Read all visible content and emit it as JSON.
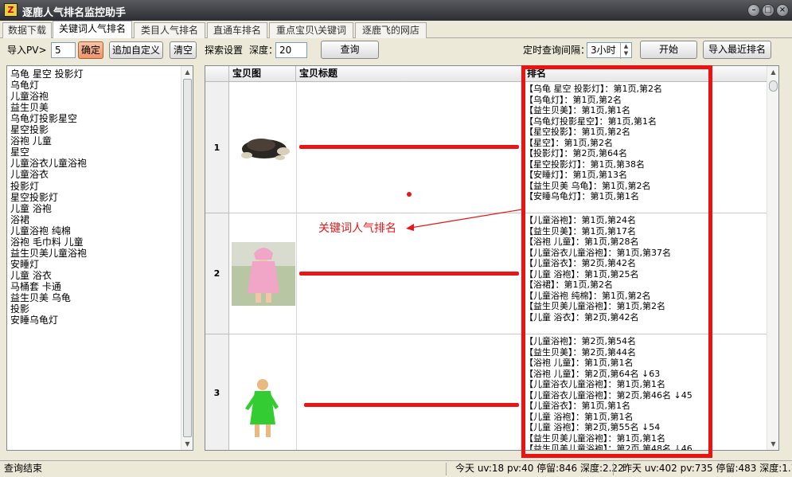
{
  "window": {
    "title": "逐鹿人气排名监控助手",
    "icon_text": "Z"
  },
  "tabs": [
    "数据下载",
    "关键词人气排名",
    "类目人气排名",
    "直通车排名",
    "重点宝贝\\关键词",
    "逐鹿飞的网店"
  ],
  "toolbar": {
    "import_pv_label": "导入PV>",
    "import_pv_value": "5",
    "confirm_label": "确定",
    "add_custom_label": "追加自定义",
    "clear_label": "清空",
    "search_settings_label": "探索设置",
    "depth_label": "深度：",
    "depth_value": "20",
    "query_label": "查询",
    "interval_label": "定时查询间隔：",
    "interval_value": "3小时",
    "start_label": "开始",
    "import_recent_label": "导入最近排名"
  },
  "keywords": [
    "乌龟 星空 投影灯",
    "乌龟灯",
    "儿童浴袍",
    "益生贝美",
    "乌龟灯投影星空",
    "星空投影",
    "浴袍 儿童",
    "星空",
    "儿童浴衣儿童浴袍",
    "儿童浴衣",
    "投影灯",
    "星空投影灯",
    "儿童 浴袍",
    "浴裙",
    "儿童浴袍 纯棉",
    "浴袍 毛巾料 儿童",
    "益生贝美儿童浴袍",
    "安睡灯",
    "儿童 浴衣",
    "马桶套 卡通",
    "益生贝美 乌龟",
    "投影",
    "安睡乌龟灯"
  ],
  "grid": {
    "headers": {
      "image": "宝贝图",
      "title": "宝贝标题",
      "rank": "排名"
    },
    "rows": [
      {
        "num": "1",
        "image_icon": "turtle-lamp-image",
        "ranks": [
          "【乌龟 星空 投影灯】：第1页,第2名",
          "【乌龟灯】：第1页,第2名",
          "【益生贝美】：第1页,第1名",
          "【乌龟灯投影星空】：第1页,第1名",
          "【星空投影】：第1页,第2名",
          "【星空】：第1页,第2名",
          "【投影灯】：第2页,第64名",
          "【星空投影灯】：第1页,第38名",
          "【安睡灯】：第1页,第13名",
          "【益生贝美 乌龟】：第1页,第2名",
          "【安睡乌龟灯】：第1页,第1名"
        ]
      },
      {
        "num": "2",
        "image_icon": "pink-bathrobe-child-image",
        "ranks": [
          "【儿童浴袍】：第1页,第24名",
          "【益生贝美】：第1页,第17名",
          "【浴袍 儿童】：第1页,第28名",
          "【儿童浴衣儿童浴袍】：第1页,第37名",
          "【儿童浴衣】：第2页,第42名",
          "【儿童 浴袍】：第1页,第25名",
          "【浴裙】：第1页,第2名",
          "【儿童浴袍 纯棉】：第1页,第2名",
          "【益生贝美儿童浴袍】：第1页,第2名",
          "【儿童 浴衣】：第2页,第42名"
        ]
      },
      {
        "num": "3",
        "image_icon": "green-bathrobe-child-image",
        "ranks": [
          "【儿童浴袍】：第2页,第54名",
          "【益生贝美】：第2页,第44名",
          "【浴袍 儿童】：第1页,第1名",
          "【浴袍 儿童】：第2页,第64名 ↓63",
          "【儿童浴衣儿童浴袍】：第1页,第1名",
          "【儿童浴衣儿童浴袍】：第2页,第46名 ↓45",
          "【儿童浴衣】：第1页,第1名",
          "【儿童 浴袍】：第1页,第1名",
          "【儿童 浴袍】：第2页,第55名 ↓54",
          "【益生贝美儿童浴袍】：第1页,第1名",
          "【益生贝美儿童浴袍】：第2页,第48名 ↓46"
        ]
      }
    ]
  },
  "annotation": {
    "text": "关键词人气排名",
    "color": "#e81616"
  },
  "status": {
    "left": "查询结束",
    "today": "今天 uv:18 pv:40 停留:846 深度:2.22",
    "yesterday": "昨天 uv:402 pv:735 停留:483 深度:1.71"
  }
}
